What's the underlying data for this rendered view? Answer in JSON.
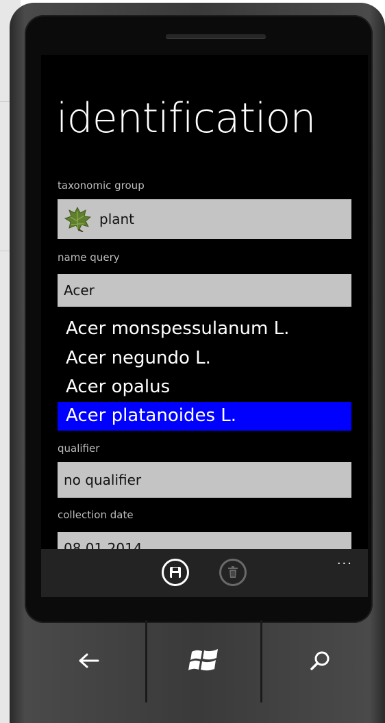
{
  "screen": {
    "page_title": "identification",
    "taxonomic_group": {
      "label": "taxonomic group",
      "value": "plant",
      "icon": "leaf-icon"
    },
    "name_query": {
      "label": "name query",
      "value": "Acer"
    },
    "suggestions": [
      {
        "text": "Acer monspessulanum L.",
        "selected": false
      },
      {
        "text": "Acer negundo L.",
        "selected": false
      },
      {
        "text": "Acer opalus",
        "selected": false
      },
      {
        "text": "Acer platanoides L.",
        "selected": true
      }
    ],
    "qualifier": {
      "label": "qualifier",
      "value": "no qualifier"
    },
    "collection_date": {
      "label": "collection date",
      "value": "08.01.2014"
    }
  },
  "app_bar": {
    "buttons": [
      {
        "icon": "save-icon",
        "enabled": true
      },
      {
        "icon": "delete-icon",
        "enabled": false
      }
    ],
    "more": "..."
  },
  "hardware_keys": [
    "back-arrow-icon",
    "windows-logo-icon",
    "search-icon"
  ],
  "colors": {
    "accent": "#0000ff",
    "screen_bg": "#000000",
    "field_bg": "#c4c4c4",
    "app_bar_bg": "#232323"
  }
}
